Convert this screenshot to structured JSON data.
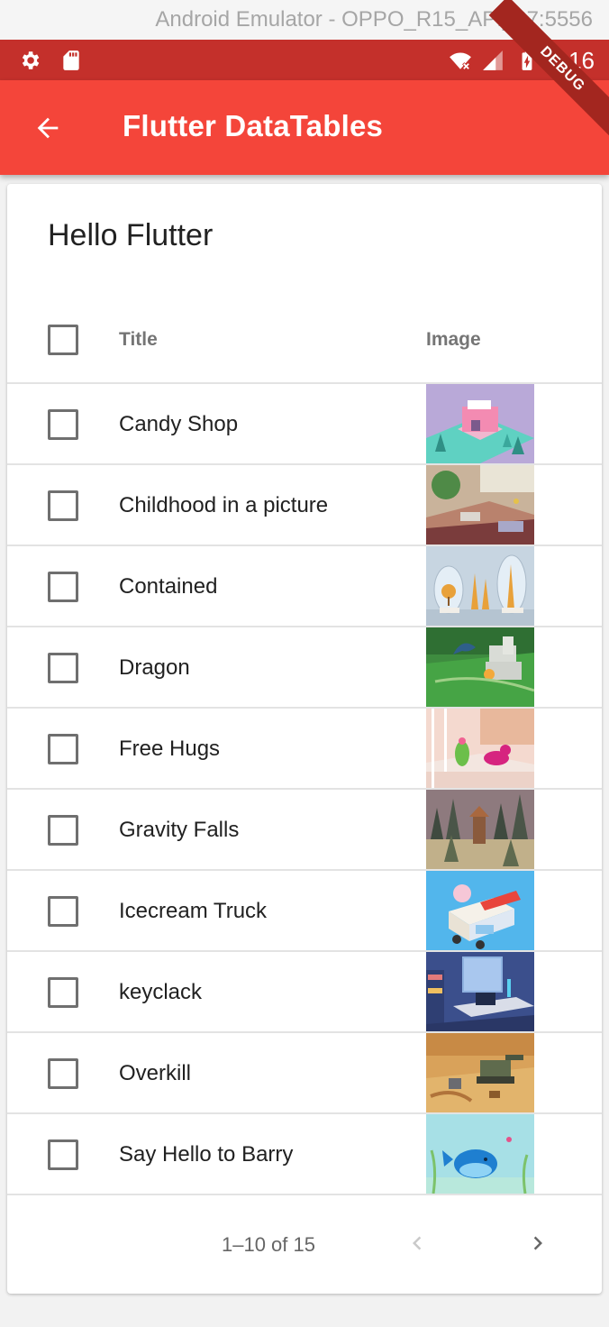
{
  "emulator": {
    "title": "Android Emulator - OPPO_R15_API_27:5556"
  },
  "status_bar": {
    "time": "4:16",
    "debug_label": "DEBUG",
    "color": "#c4302b"
  },
  "app_bar": {
    "title": "Flutter DataTables",
    "color": "#f4453a"
  },
  "card": {
    "header": "Hello Flutter"
  },
  "table": {
    "columns": [
      "Title",
      "Image"
    ],
    "rows": [
      {
        "title": "Candy Shop",
        "image": "candy-shop-thumbnail"
      },
      {
        "title": "Childhood in a picture",
        "image": "childhood-thumbnail"
      },
      {
        "title": "Contained",
        "image": "contained-thumbnail"
      },
      {
        "title": "Dragon",
        "image": "dragon-thumbnail"
      },
      {
        "title": "Free Hugs",
        "image": "free-hugs-thumbnail"
      },
      {
        "title": "Gravity Falls",
        "image": "gravity-falls-thumbnail"
      },
      {
        "title": "Icecream Truck",
        "image": "icecream-truck-thumbnail"
      },
      {
        "title": "keyclack",
        "image": "keyclack-thumbnail"
      },
      {
        "title": "Overkill",
        "image": "overkill-thumbnail"
      },
      {
        "title": "Say Hello to Barry",
        "image": "barry-thumbnail"
      }
    ]
  },
  "pagination": {
    "range": "1–10 of 15"
  }
}
